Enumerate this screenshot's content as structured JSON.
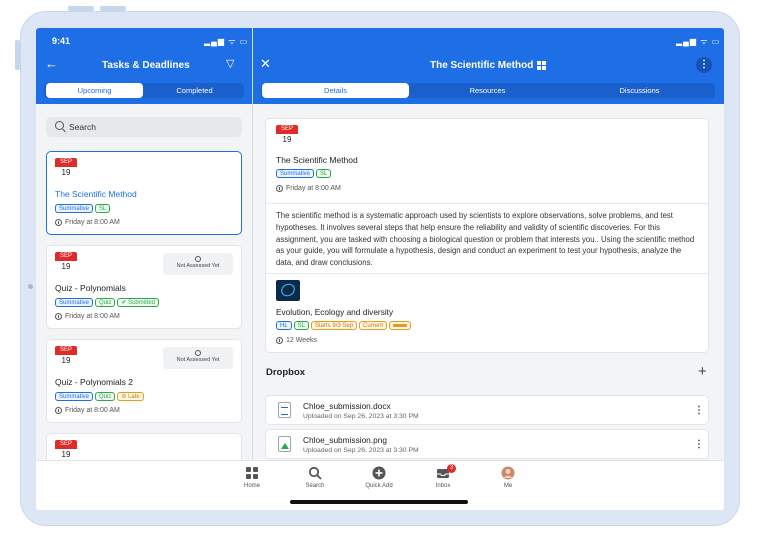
{
  "status": {
    "time": "9:41",
    "icons": "▂▄▆ ᯤ ▭"
  },
  "left_header": {
    "back_icon": "←",
    "title": "Tasks & Deadlines",
    "filter_icon": "▽"
  },
  "left_tabs": [
    {
      "label": "Upcoming",
      "active": true
    },
    {
      "label": "Completed",
      "active": false
    }
  ],
  "search": {
    "placeholder": "Search"
  },
  "tasks": [
    {
      "month": "SEP",
      "day": "19",
      "title": "The Scientific Method",
      "tags": [
        "Summative",
        "SL"
      ],
      "due": "Friday at 8:00 AM",
      "status": ""
    },
    {
      "month": "SEP",
      "day": "19",
      "title": "Quiz - Polynomials",
      "tags": [
        "Summative",
        "Quiz",
        "Submitted"
      ],
      "due": "Friday at 8:00 AM",
      "status": "Not Assessed Yet"
    },
    {
      "month": "SEP",
      "day": "19",
      "title": "Quiz - Polynomials 2",
      "tags": [
        "Summative",
        "Quiz",
        "Late"
      ],
      "due": "Friday at 8:00 AM",
      "status": "Not Assessed Yet"
    },
    {
      "month": "SEP",
      "day": "19"
    }
  ],
  "right_header": {
    "close_icon": "✕",
    "title": "The Scientific Method",
    "more_icon": "⋮"
  },
  "right_tabs": [
    {
      "label": "Details",
      "active": true
    },
    {
      "label": "Resources",
      "active": false
    },
    {
      "label": "Discussions",
      "active": false
    }
  ],
  "detail": {
    "month": "SEP",
    "day": "19",
    "title": "The Scientific Method",
    "tags": [
      "Summative",
      "SL"
    ],
    "due": "Friday at 8:00 AM",
    "description": "The scientific method is a systematic approach used by scientists to explore observations, solve problems, and test hypotheses. It involves several steps that help ensure the reliability and validity of scientific discoveries. For this assignment, you are tasked with choosing a biological question or problem that interests you.. Using the scientific method as your guide, you will formulate a hypothesis, design and conduct an experiment to test your hypothesis, analyze the data, and draw conclusions.",
    "unit_title": "Evolution, Ecology and diversity",
    "unit_tags": [
      "HL",
      "SL",
      "Starts 9/3 Sep",
      "Current"
    ],
    "unit_duration": "12 Weeks"
  },
  "dropbox": {
    "title": "Dropbox",
    "add_icon": "+",
    "files": [
      {
        "name": "Chloe_submission.docx",
        "meta": "Uploaded on Sep 26, 2023 at 3:30 PM",
        "icon": "doc-icon"
      },
      {
        "name": "Chloe_submission.png",
        "meta": "Uploaded on Sep 26, 2023 at 3:30 PM",
        "icon": "image-icon"
      }
    ]
  },
  "tabbar": [
    {
      "label": "Home",
      "icon": "grid-icon"
    },
    {
      "label": "Search",
      "icon": "search-icon"
    },
    {
      "label": "Quick Add",
      "icon": "plus-circle-icon"
    },
    {
      "label": "Inbox",
      "icon": "inbox-icon",
      "badge": "3"
    },
    {
      "label": "Me",
      "icon": "avatar-icon"
    }
  ],
  "colors": {
    "brand": "#1e6ee6",
    "danger": "#e02b2b",
    "success": "#2aa84a",
    "warning": "#e89a1c"
  }
}
